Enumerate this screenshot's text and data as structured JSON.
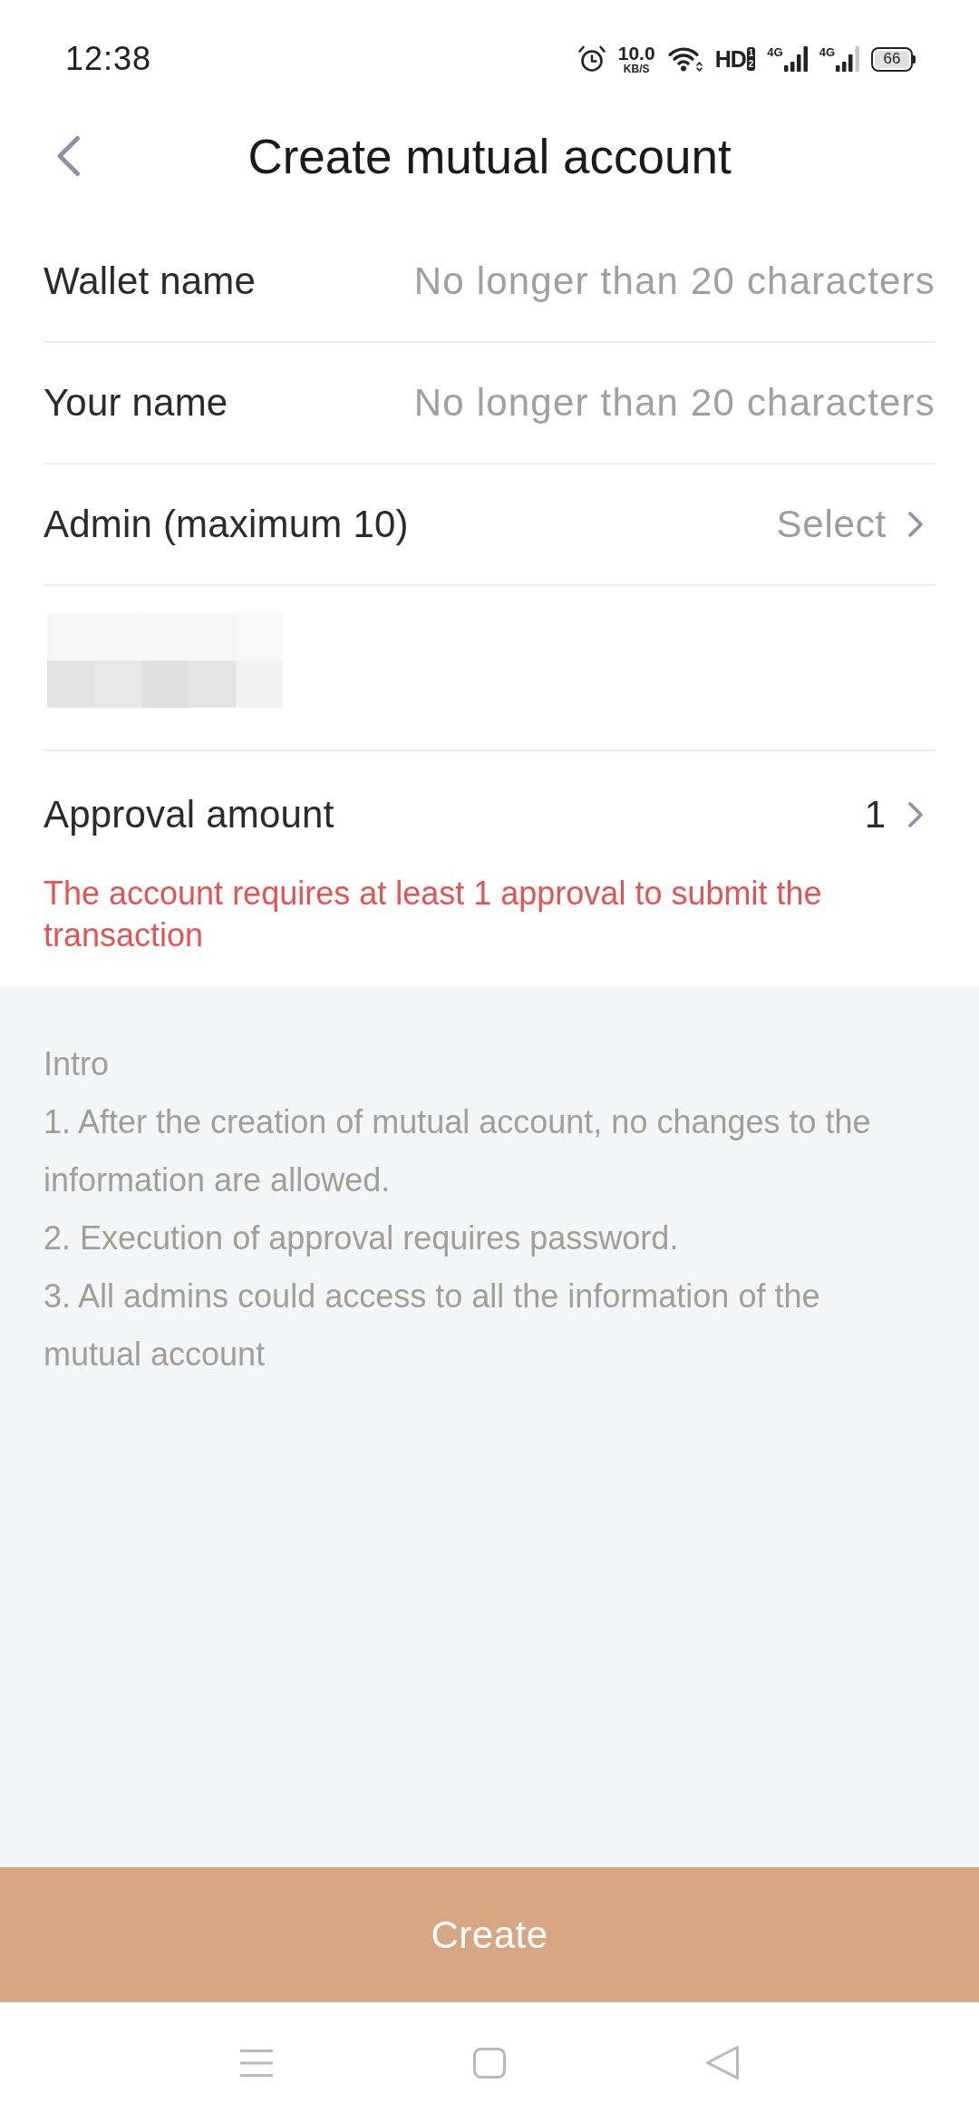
{
  "status_bar": {
    "time": "12:38",
    "network_speed": "10.0",
    "speed_unit": "KB/S",
    "hd_label": "HD",
    "hd_slots": [
      "1",
      "2"
    ],
    "signals": [
      {
        "network": "4G"
      },
      {
        "network": "4G"
      }
    ],
    "battery": "66"
  },
  "header": {
    "title": "Create mutual account"
  },
  "form": {
    "rows": [
      {
        "kind": "input",
        "label": "Wallet name",
        "placeholder": "No longer than 20 characters"
      },
      {
        "kind": "input",
        "label": "Your name",
        "placeholder": "No longer than 20 characters"
      },
      {
        "kind": "picker",
        "label": "Admin (maximum 10)",
        "placeholder": "Select"
      },
      {
        "kind": "redacted"
      },
      {
        "kind": "picker",
        "label": "Approval amount",
        "value": "1",
        "error": "The account requires at least 1 approval to submit the transaction"
      }
    ]
  },
  "intro": {
    "title": "Intro",
    "items": [
      "1. After the creation of mutual account, no changes to the information are allowed.",
      "2. Execution of approval requires password.",
      "3. All admins could access to all the information of the mutual account"
    ]
  },
  "primary_button": {
    "label": "Create"
  }
}
